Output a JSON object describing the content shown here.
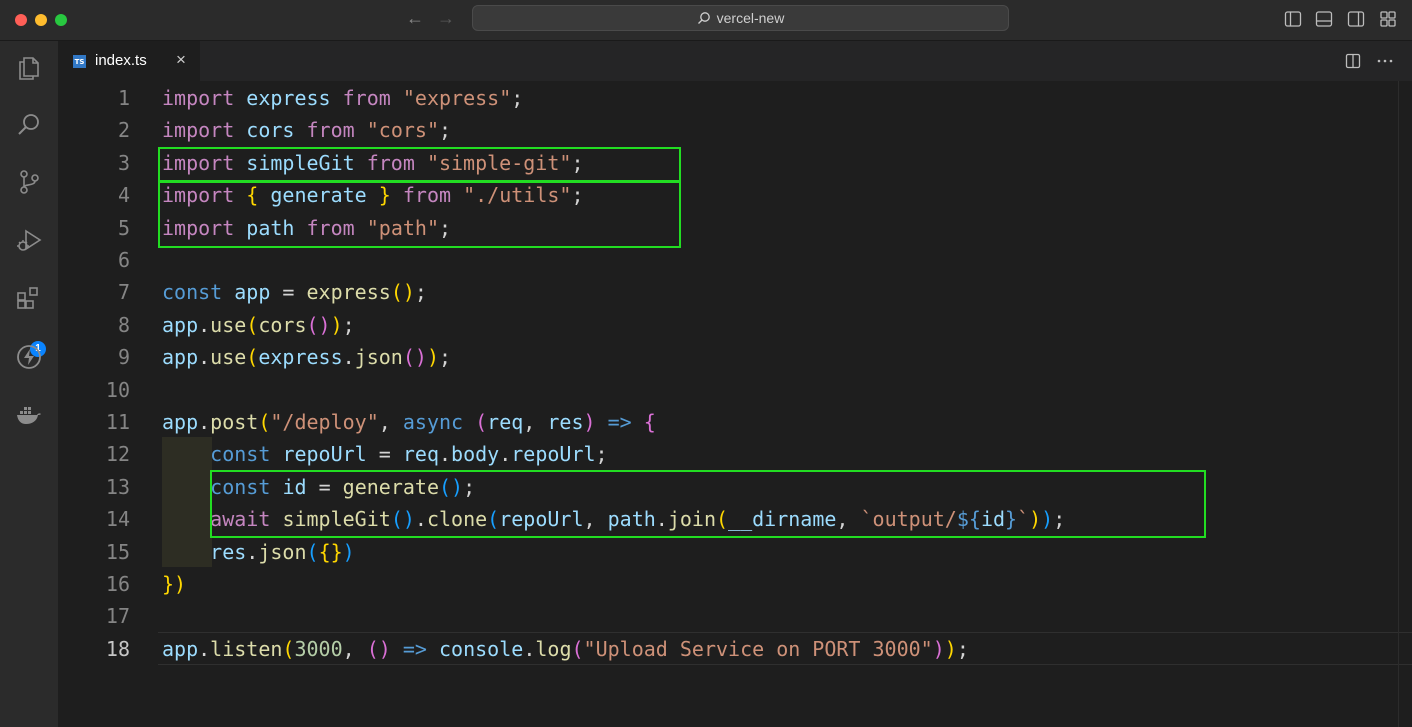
{
  "window": {
    "search_text": "vercel-new"
  },
  "activity_bar": {
    "icons": [
      "files-icon",
      "search-icon",
      "source-control-icon",
      "run-debug-icon",
      "extensions-icon",
      "lightning-icon",
      "docker-icon"
    ],
    "extensions_badge": "1"
  },
  "tab": {
    "label": "index.ts",
    "icon_text": "TS",
    "close": "×"
  },
  "editor": {
    "active_line": 18,
    "line_numbers": [
      "1",
      "2",
      "3",
      "4",
      "5",
      "6",
      "7",
      "8",
      "9",
      "10",
      "11",
      "12",
      "13",
      "14",
      "15",
      "16",
      "17",
      "18"
    ],
    "lines": [
      [
        [
          "kw",
          "import"
        ],
        [
          "p",
          " "
        ],
        [
          "var",
          "express"
        ],
        [
          "p",
          " "
        ],
        [
          "kw",
          "from"
        ],
        [
          "p",
          " "
        ],
        [
          "str",
          "\"express\""
        ],
        [
          "p",
          ";"
        ]
      ],
      [
        [
          "kw",
          "import"
        ],
        [
          "p",
          " "
        ],
        [
          "var",
          "cors"
        ],
        [
          "p",
          " "
        ],
        [
          "kw",
          "from"
        ],
        [
          "p",
          " "
        ],
        [
          "str",
          "\"cors\""
        ],
        [
          "p",
          ";"
        ]
      ],
      [
        [
          "kw",
          "import"
        ],
        [
          "p",
          " "
        ],
        [
          "var",
          "simpleGit"
        ],
        [
          "p",
          " "
        ],
        [
          "kw",
          "from"
        ],
        [
          "p",
          " "
        ],
        [
          "str",
          "\"simple-git\""
        ],
        [
          "p",
          ";"
        ]
      ],
      [
        [
          "kw",
          "import"
        ],
        [
          "p",
          " "
        ],
        [
          "b1",
          "{"
        ],
        [
          "p",
          " "
        ],
        [
          "var",
          "generate"
        ],
        [
          "p",
          " "
        ],
        [
          "b1",
          "}"
        ],
        [
          "p",
          " "
        ],
        [
          "kw",
          "from"
        ],
        [
          "p",
          " "
        ],
        [
          "str",
          "\"./utils\""
        ],
        [
          "p",
          ";"
        ]
      ],
      [
        [
          "kw",
          "import"
        ],
        [
          "p",
          " "
        ],
        [
          "var",
          "path"
        ],
        [
          "p",
          " "
        ],
        [
          "kw",
          "from"
        ],
        [
          "p",
          " "
        ],
        [
          "str",
          "\"path\""
        ],
        [
          "p",
          ";"
        ]
      ],
      [],
      [
        [
          "dk",
          "const"
        ],
        [
          "p",
          " "
        ],
        [
          "var",
          "app"
        ],
        [
          "p",
          " = "
        ],
        [
          "fn",
          "express"
        ],
        [
          "b1",
          "()"
        ],
        [
          "p",
          ";"
        ]
      ],
      [
        [
          "var",
          "app"
        ],
        [
          "p",
          "."
        ],
        [
          "fn",
          "use"
        ],
        [
          "b1",
          "("
        ],
        [
          "fn",
          "cors"
        ],
        [
          "b2",
          "()"
        ],
        [
          "b1",
          ")"
        ],
        [
          "p",
          ";"
        ]
      ],
      [
        [
          "var",
          "app"
        ],
        [
          "p",
          "."
        ],
        [
          "fn",
          "use"
        ],
        [
          "b1",
          "("
        ],
        [
          "var",
          "express"
        ],
        [
          "p",
          "."
        ],
        [
          "fn",
          "json"
        ],
        [
          "b2",
          "()"
        ],
        [
          "b1",
          ")"
        ],
        [
          "p",
          ";"
        ]
      ],
      [],
      [
        [
          "var",
          "app"
        ],
        [
          "p",
          "."
        ],
        [
          "fn",
          "post"
        ],
        [
          "b1",
          "("
        ],
        [
          "str",
          "\"/deploy\""
        ],
        [
          "p",
          ", "
        ],
        [
          "dk",
          "async"
        ],
        [
          "p",
          " "
        ],
        [
          "b2",
          "("
        ],
        [
          "var",
          "req"
        ],
        [
          "p",
          ", "
        ],
        [
          "var",
          "res"
        ],
        [
          "b2",
          ")"
        ],
        [
          "p",
          " "
        ],
        [
          "dk",
          "=>"
        ],
        [
          "p",
          " "
        ],
        [
          "b2",
          "{"
        ]
      ],
      [
        [
          "p",
          "    "
        ],
        [
          "dk",
          "const"
        ],
        [
          "p",
          " "
        ],
        [
          "var",
          "repoUrl"
        ],
        [
          "p",
          " = "
        ],
        [
          "var",
          "req"
        ],
        [
          "p",
          "."
        ],
        [
          "var",
          "body"
        ],
        [
          "p",
          "."
        ],
        [
          "var",
          "repoUrl"
        ],
        [
          "p",
          ";"
        ]
      ],
      [
        [
          "p",
          "    "
        ],
        [
          "dk",
          "const"
        ],
        [
          "p",
          " "
        ],
        [
          "var",
          "id"
        ],
        [
          "p",
          " = "
        ],
        [
          "fn",
          "generate"
        ],
        [
          "b3",
          "()"
        ],
        [
          "p",
          ";"
        ]
      ],
      [
        [
          "p",
          "    "
        ],
        [
          "kw",
          "await"
        ],
        [
          "p",
          " "
        ],
        [
          "fn",
          "simpleGit"
        ],
        [
          "b3",
          "()"
        ],
        [
          "p",
          "."
        ],
        [
          "fn",
          "clone"
        ],
        [
          "b3",
          "("
        ],
        [
          "var",
          "repoUrl"
        ],
        [
          "p",
          ", "
        ],
        [
          "var",
          "path"
        ],
        [
          "p",
          "."
        ],
        [
          "fn",
          "join"
        ],
        [
          "b1",
          "("
        ],
        [
          "var",
          "__dirname"
        ],
        [
          "p",
          ", "
        ],
        [
          "str",
          "`output/"
        ],
        [
          "dk",
          "${"
        ],
        [
          "var",
          "id"
        ],
        [
          "dk",
          "}"
        ],
        [
          "str",
          "`"
        ],
        [
          "b1",
          ")"
        ],
        [
          "b3",
          ")"
        ],
        [
          "p",
          ";"
        ]
      ],
      [
        [
          "p",
          "    "
        ],
        [
          "var",
          "res"
        ],
        [
          "p",
          "."
        ],
        [
          "fn",
          "json"
        ],
        [
          "b3",
          "("
        ],
        [
          "b1",
          "{}"
        ],
        [
          "b3",
          ")"
        ]
      ],
      [
        [
          "b1",
          "})"
        ]
      ],
      [],
      [
        [
          "var",
          "app"
        ],
        [
          "p",
          "."
        ],
        [
          "fn",
          "listen"
        ],
        [
          "b1",
          "("
        ],
        [
          "num",
          "3000"
        ],
        [
          "p",
          ", "
        ],
        [
          "b2",
          "()"
        ],
        [
          "p",
          " "
        ],
        [
          "dk",
          "=>"
        ],
        [
          "p",
          " "
        ],
        [
          "var",
          "console"
        ],
        [
          "p",
          "."
        ],
        [
          "fn",
          "log"
        ],
        [
          "b2",
          "("
        ],
        [
          "str",
          "\"Upload Service on PORT 3000\""
        ],
        [
          "b2",
          ")"
        ],
        [
          "b1",
          ")"
        ],
        [
          "p",
          ";"
        ]
      ]
    ]
  }
}
